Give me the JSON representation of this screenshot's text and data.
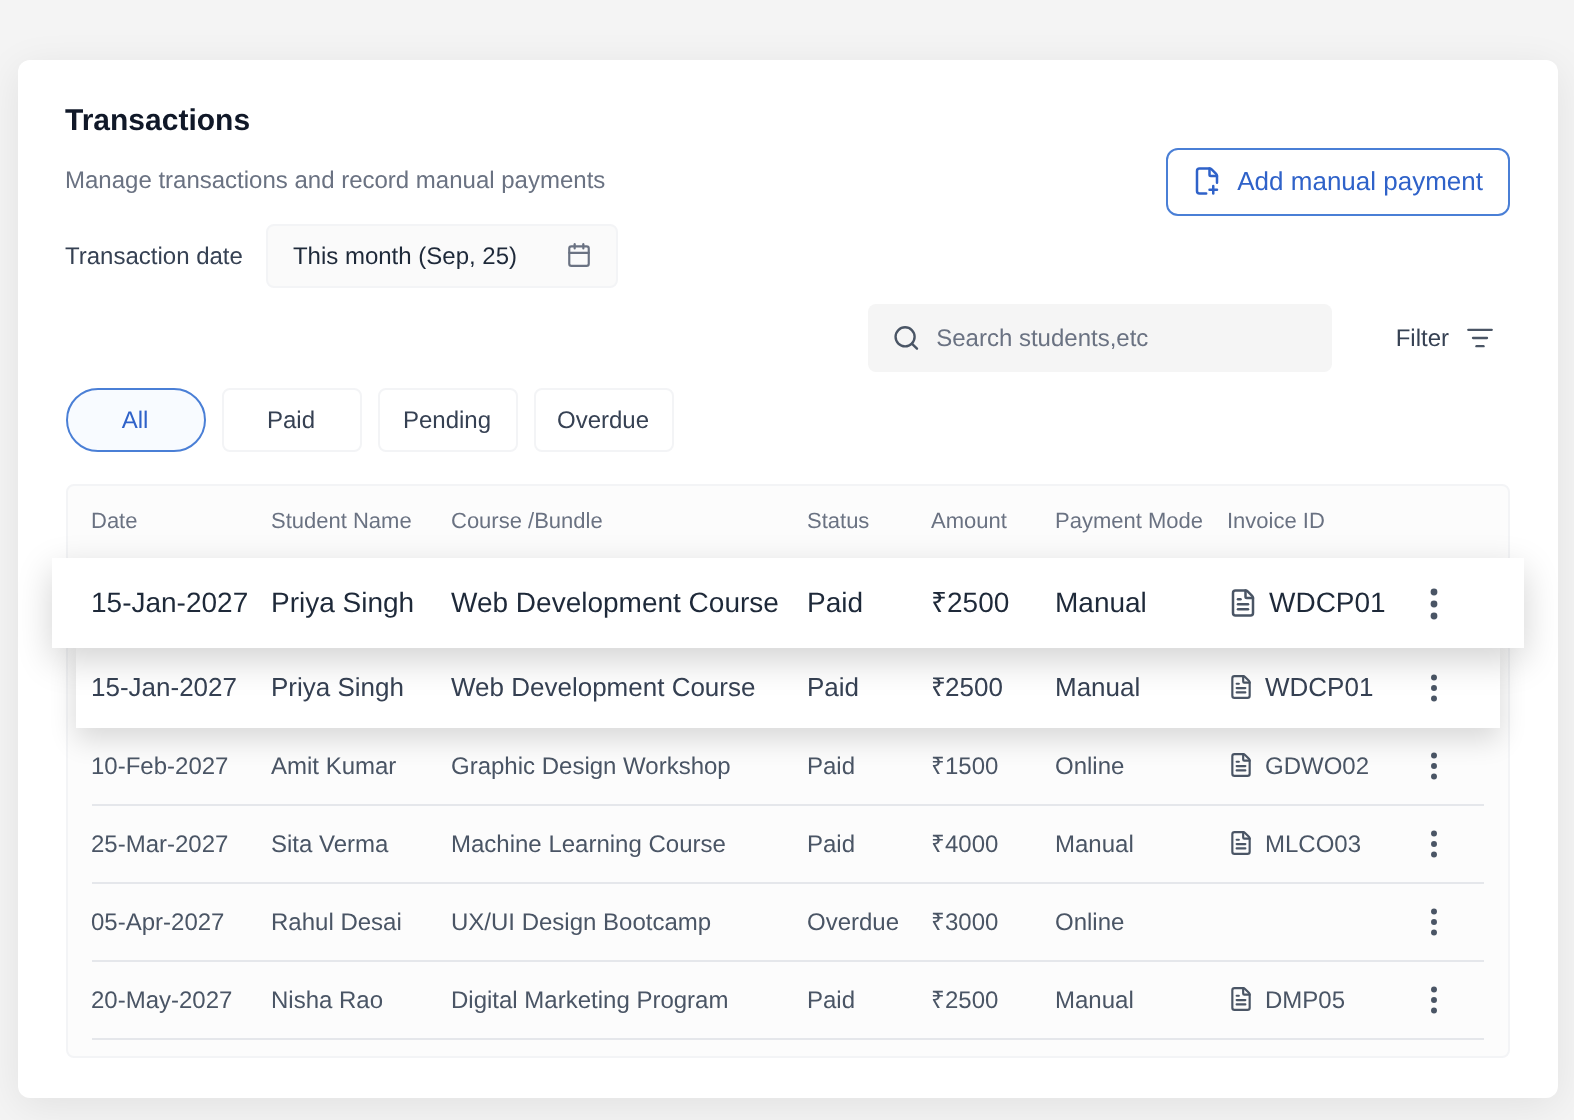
{
  "header": {
    "title": "Transactions",
    "subtitle": "Manage transactions and record manual payments"
  },
  "add_button": {
    "label": "Add manual payment"
  },
  "date_filter": {
    "label": "Transaction date",
    "value": "This month (Sep, 25)"
  },
  "search": {
    "placeholder": "Search students,etc"
  },
  "filter_button": {
    "label": "Filter"
  },
  "tabs": [
    {
      "label": "All",
      "selected": true
    },
    {
      "label": "Paid",
      "selected": false
    },
    {
      "label": "Pending",
      "selected": false
    },
    {
      "label": "Overdue",
      "selected": false
    }
  ],
  "table": {
    "columns": [
      "Date",
      "Student Name",
      "Course /Bundle",
      "Status",
      "Amount",
      "Payment Mode",
      "Invoice ID"
    ],
    "highlighted_rows": [
      {
        "date": "15-Jan-2027",
        "student": "Priya Singh",
        "course": "Web Development Course",
        "status": "Paid",
        "amount": "₹2500",
        "mode": "Manual",
        "invoice": "WDCP01"
      },
      {
        "date": "15-Jan-2027",
        "student": "Priya Singh",
        "course": "Web Development Course",
        "status": "Paid",
        "amount": "₹2500",
        "mode": "Manual",
        "invoice": "WDCP01"
      }
    ],
    "rows": [
      {
        "date": "10-Feb-2027",
        "student": "Amit Kumar",
        "course": "Graphic Design Workshop",
        "status": "Paid",
        "amount": "₹1500",
        "mode": "Online",
        "invoice": "GDWO02"
      },
      {
        "date": "25-Mar-2027",
        "student": "Sita Verma",
        "course": "Machine Learning Course",
        "status": "Paid",
        "amount": "₹4000",
        "mode": "Manual",
        "invoice": "MLCO03"
      },
      {
        "date": "05-Apr-2027",
        "student": "Rahul Desai",
        "course": "UX/UI Design Bootcamp",
        "status": "Overdue",
        "amount": "₹3000",
        "mode": "Online"
      },
      {
        "date": "20-May-2027",
        "student": "Nisha Rao",
        "course": "Digital Marketing Program",
        "status": "Paid",
        "amount": "₹2500",
        "mode": "Manual",
        "invoice": "DMP05"
      }
    ]
  }
}
